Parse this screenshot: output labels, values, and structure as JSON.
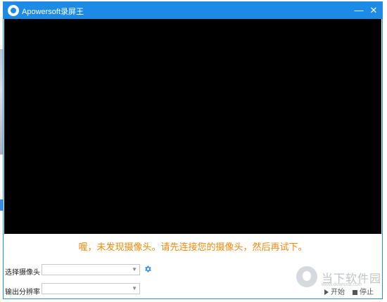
{
  "window": {
    "title": "Apowersoft录屏王",
    "minimize_glyph": "—",
    "close_glyph": "✕",
    "accent_color": "#1c8be6"
  },
  "video": {
    "message": "喔，未发现摄像头。请先连接您的摄像头，然后再试下。",
    "message_color": "#f08a0a"
  },
  "controls": {
    "camera_label": "选择摄像头",
    "camera_value": "",
    "resolution_label": "输出分辨率",
    "resolution_value": "",
    "settings_icon": "gear-icon"
  },
  "footer": {
    "watermark": "当下软件园",
    "watermark_url": "www.downxia.com",
    "start_label": "开始",
    "stop_label": "停止"
  }
}
